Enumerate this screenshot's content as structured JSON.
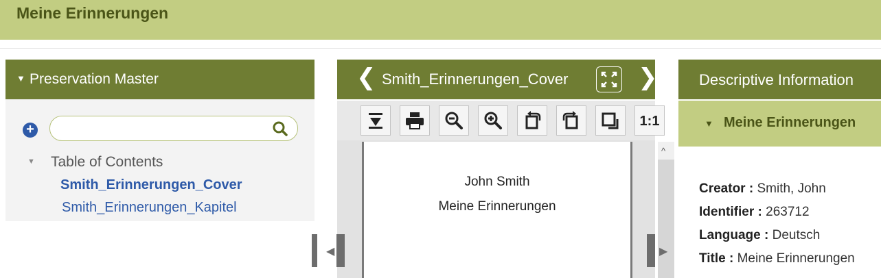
{
  "app": {
    "title": "Meine Erinnerungen"
  },
  "left_panel": {
    "header": "Preservation Master",
    "search": {
      "value": "",
      "placeholder": ""
    },
    "toc": {
      "label": "Table of Contents",
      "items": [
        "Smith_Erinnerungen_Cover",
        "Smith_Erinnerungen_Kapitel"
      ]
    }
  },
  "viewer": {
    "filename": "Smith_Erinnerungen_Cover",
    "zoom_actual_label": "1:1",
    "toolbar_icons": [
      "download-icon",
      "print-icon",
      "zoom-out-icon",
      "zoom-in-icon",
      "rotate-left-icon",
      "rotate-right-icon",
      "fit-icon"
    ],
    "page_text": {
      "line1": "John Smith",
      "line2": "Meine Erinnerungen"
    }
  },
  "right_panel": {
    "header": "Descriptive Information",
    "section_title": "Meine Erinnerungen",
    "metadata": [
      {
        "label": "Creator :",
        "value": "Smith, John"
      },
      {
        "label": "Identifier :",
        "value": "263712"
      },
      {
        "label": "Language :",
        "value": "Deutsch"
      },
      {
        "label": "Title :",
        "value": "Meine Erinnerungen"
      }
    ]
  },
  "colors": {
    "header_light": "#c2cd82",
    "header_dark": "#6f7d33",
    "link": "#2e5aa8"
  }
}
